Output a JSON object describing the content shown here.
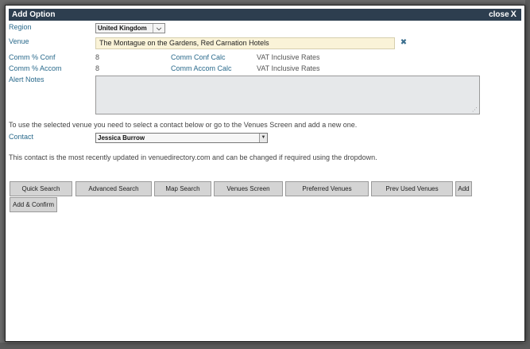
{
  "dialog": {
    "title": "Add Option",
    "close_label": "close",
    "close_glyph": "X"
  },
  "form": {
    "region_label": "Region",
    "region_value": "United Kingdom",
    "venue_label": "Venue",
    "venue_value": "The Montague on the Gardens, Red Carnation Hotels",
    "clear_glyph": "✖",
    "comm_conf_label": "Comm % Conf",
    "comm_conf_value": "8",
    "comm_conf_calc_label": "Comm Conf Calc",
    "comm_conf_calc_value": "VAT Inclusive Rates",
    "comm_accom_label": "Comm % Accom",
    "comm_accom_value": "8",
    "comm_accom_calc_label": "Comm Accom Calc",
    "comm_accom_calc_value": "VAT Inclusive Rates",
    "alert_notes_label": "Alert Notes",
    "alert_notes_value": "",
    "select_contact_hint": "To use the selected venue you need to select a contact below or go to the Venues Screen and add a new one.",
    "contact_label": "Contact",
    "contact_value": "Jessica Burrow",
    "contact_note": "This contact is the most recently updated in venuedirectory.com and can be changed if required using the dropdown."
  },
  "buttons": {
    "quick_search": "Quick Search",
    "advanced_search": "Advanced Search",
    "map_search": "Map Search",
    "venues_screen": "Venues Screen",
    "preferred_venues": "Preferred Venues",
    "prev_used_venues": "Prev Used Venues",
    "add": "Add",
    "add_confirm": "Add & Confirm"
  },
  "icons": {
    "region_arrow": "chevron-down-icon",
    "contact_arrow": "dropdown-arrow-icon",
    "clear": "clear-icon",
    "resize": "resize-grip-icon"
  },
  "colors": {
    "titlebar": "#2d3e4f",
    "label": "#2a6a8c",
    "venue_bg": "#faf3d8",
    "button_bg": "#d4d4d4"
  }
}
